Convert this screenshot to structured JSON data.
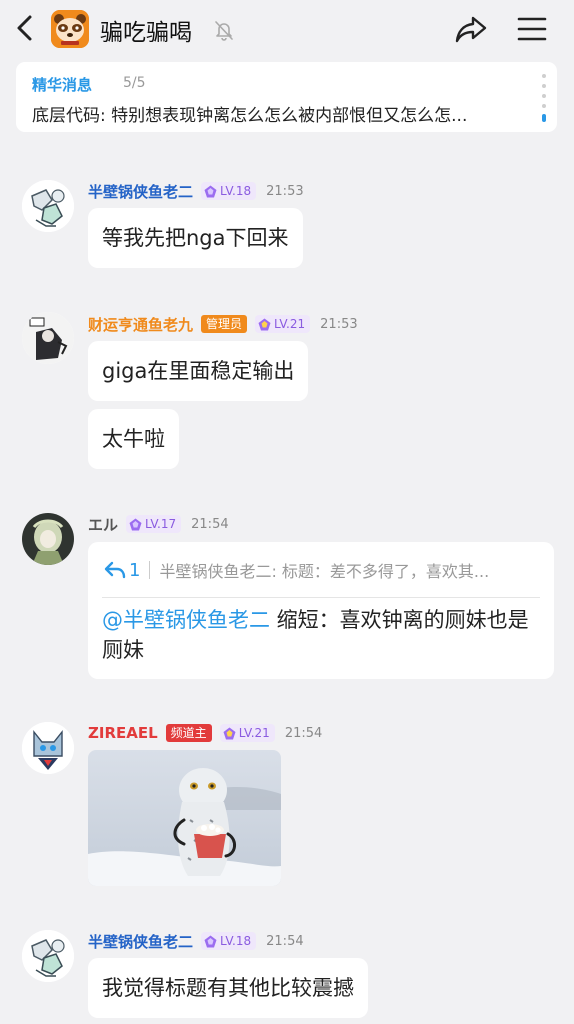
{
  "header": {
    "title": "骗吃骗喝",
    "icons": {
      "back": "chevron-left-icon",
      "logo": "raccoon-logo-icon",
      "mute": "bell-off-icon",
      "share": "share-arrow-icon",
      "menu": "hamburger-menu-icon"
    }
  },
  "pinned": {
    "title": "精华消息",
    "count": "5/5",
    "body": "底层代码: 特别想表现钟离怎么怎么被内部恨但又怎么怎..."
  },
  "messages": [
    {
      "name": "半壁锅侠鱼老二",
      "level": "LV.18",
      "time": "21:53",
      "bubbles": [
        "等我先把nga下回来"
      ]
    },
    {
      "name": "财运亨通鱼老九",
      "role": "管理员",
      "level": "LV.21",
      "time": "21:53",
      "bubbles": [
        "giga在里面稳定输出",
        "太牛啦"
      ]
    },
    {
      "name": "エル",
      "level": "LV.17",
      "time": "21:54",
      "reply": {
        "count": "1",
        "quote": "半壁锅侠鱼老二: 标题：差不多得了，喜欢其...",
        "mention": "@半壁锅侠鱼老二",
        "text": " 缩短：喜欢钟离的厕妹也是厕妹"
      }
    },
    {
      "name": "ZIREAEL",
      "role": "频道主",
      "level": "LV.21",
      "time": "21:54",
      "image": "snowy-owl-holding-cup-photo"
    },
    {
      "name": "半壁锅侠鱼老二",
      "level": "LV.18",
      "time": "21:54",
      "bubbles": [
        "我觉得标题有其他比较震撼"
      ]
    }
  ],
  "colors": {
    "accent": "#2a98e6",
    "name_blue": "#2463c7",
    "admin": "#f08a1c",
    "owner": "#e23b3b",
    "level": "#8a5be0"
  }
}
